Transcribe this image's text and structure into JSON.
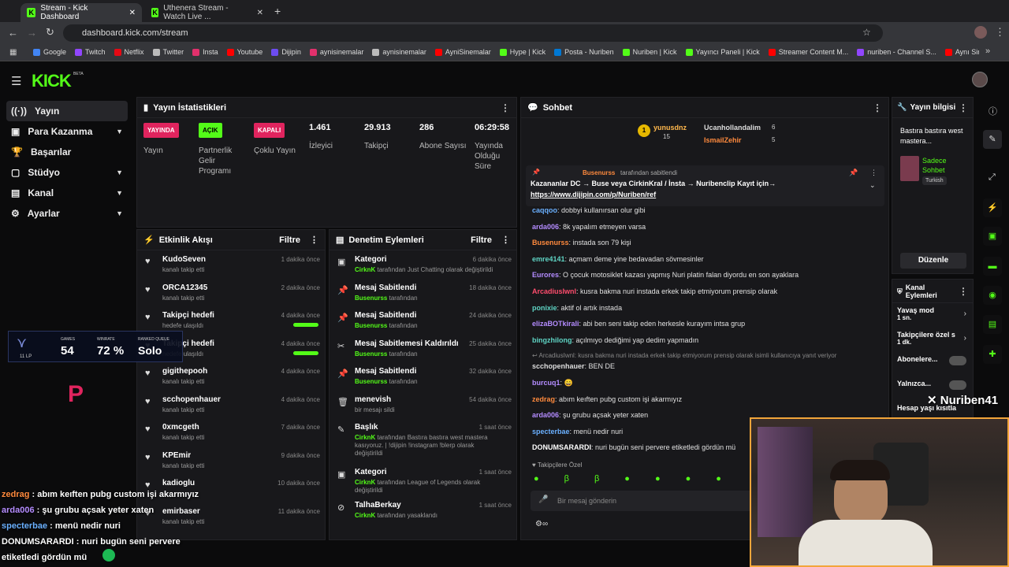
{
  "browser": {
    "tabs": [
      {
        "label": "Stream - Kick Dashboard"
      },
      {
        "label": "Uthenera Stream - Watch Live ..."
      }
    ],
    "url": "dashboard.kick.com/stream",
    "bookmarks": [
      {
        "label": "Google",
        "color": "#4285f4"
      },
      {
        "label": "Twitch",
        "color": "#9146ff"
      },
      {
        "label": "Netflix",
        "color": "#e50914"
      },
      {
        "label": "Twitter",
        "color": "#bbbbbb"
      },
      {
        "label": "Insta",
        "color": "#e1306c"
      },
      {
        "label": "Youtube",
        "color": "#ff0000"
      },
      {
        "label": "Dijipin",
        "color": "#6c4cf0"
      },
      {
        "label": "aynisinemalar",
        "color": "#e1306c"
      },
      {
        "label": "aynisinemalar",
        "color": "#bbbbbb"
      },
      {
        "label": "AyniSinemalar",
        "color": "#ff0000"
      },
      {
        "label": "Hype | Kick",
        "color": "#53fc18"
      },
      {
        "label": "Posta - Nuriben",
        "color": "#0078d4"
      },
      {
        "label": "Nuriben | Kick",
        "color": "#53fc18"
      },
      {
        "label": "Yayıncı Paneli | Kick",
        "color": "#53fc18"
      },
      {
        "label": "Streamer Content M...",
        "color": "#ff0000"
      },
      {
        "label": "nuriben - Channel S...",
        "color": "#9146ff"
      },
      {
        "label": "Aynı Sinemalar - Ça...",
        "color": "#ff0000"
      }
    ]
  },
  "brand": {
    "logo": "KICK",
    "beta": "BETA"
  },
  "sidebar": {
    "items": [
      {
        "label": "Yayın",
        "icon": "broadcast-icon"
      },
      {
        "label": "Para Kazanma",
        "icon": "money-icon"
      },
      {
        "label": "Başarılar",
        "icon": "trophy-icon"
      },
      {
        "label": "Stüdyo",
        "icon": "studio-icon"
      },
      {
        "label": "Kanal",
        "icon": "channel-icon"
      },
      {
        "label": "Ayarlar",
        "icon": "gear-icon"
      }
    ]
  },
  "stats": {
    "title": "Yayın İstatistikleri",
    "cols": [
      {
        "badge": "YAYINDA",
        "badge_color": "#e0245e",
        "label": "Yayın"
      },
      {
        "badge": "AÇIK",
        "badge_color": "#53fc18",
        "label": "Partnerlik Gelir Programı"
      },
      {
        "badge": "KAPALI",
        "badge_color": "#e0245e",
        "label": "Çoklu Yayın"
      },
      {
        "value": "1.461",
        "label": "İzleyici"
      },
      {
        "value": "29.913",
        "label": "Takipçi"
      },
      {
        "value": "286",
        "label": "Abone Sayısı"
      },
      {
        "value": "06:29:58",
        "label": "Yayında Olduğu Süre"
      }
    ]
  },
  "events": {
    "title": "Etkinlik Akışı",
    "filter": "Filtre",
    "items": [
      {
        "name": "KudoSeven",
        "sub": "kanalı takip etti",
        "time": "1 dakika önce"
      },
      {
        "name": "ORCA12345",
        "sub": "kanalı takip etti",
        "time": "2 dakika önce"
      },
      {
        "name": "Takipçi hedefi",
        "sub": "hedefe ulaşıldı",
        "time": "4 dakika önce"
      },
      {
        "name": "Takipçi hedefi",
        "sub": "hedefe ulaşıldı",
        "time": "4 dakika önce"
      },
      {
        "name": "gigithepooh",
        "sub": "kanalı takip etti",
        "time": "4 dakika önce"
      },
      {
        "name": "scchopenhauer",
        "sub": "kanalı takip etti",
        "time": "4 dakika önce"
      },
      {
        "name": "0xmcgeth",
        "sub": "kanalı takip etti",
        "time": "7 dakika önce"
      },
      {
        "name": "KPEmir",
        "sub": "kanalı takip etti",
        "time": "9 dakika önce"
      },
      {
        "name": "kadioglu",
        "sub": "",
        "time": "10 dakika önce"
      },
      {
        "name": "emirbaser",
        "sub": "kanalı takip etti",
        "time": "11 dakika önce"
      }
    ]
  },
  "mod": {
    "title": "Denetim Eylemleri",
    "filter": "Filtre",
    "items": [
      {
        "name": "Kategori",
        "user": "CirknK",
        "sub": "tarafından Just Chatting olarak değiştirildi",
        "time": "6 dakika önce"
      },
      {
        "name": "Mesaj Sabitlendi",
        "user": "Busenurss",
        "sub": "tarafından",
        "time": "18 dakika önce"
      },
      {
        "name": "Mesaj Sabitlendi",
        "user": "Busenurss",
        "sub": "tarafından",
        "time": "24 dakika önce"
      },
      {
        "name": "Mesaj Sabitlemesi Kaldırıldı",
        "user": "Busenurss",
        "sub": "tarafından",
        "time": "25 dakika önce"
      },
      {
        "name": "Mesaj Sabitlendi",
        "user": "Busenurss",
        "sub": "tarafından",
        "time": "32 dakika önce"
      },
      {
        "name": "menevish",
        "user": "",
        "sub": "bir mesajı sildi",
        "time": "54 dakika önce"
      },
      {
        "name": "Başlık",
        "user": "CirknK",
        "sub": "tarafından Bastıra bastıra west mastera kasıyoruz. | !dijipin !instagram !blerp olarak değiştirildi",
        "time": "1 saat önce"
      },
      {
        "name": "Kategori",
        "user": "CirknK",
        "sub": "tarafından League of Legends olarak değiştirildi",
        "time": "1 saat önce"
      },
      {
        "name": "TalhaBerkay",
        "user": "CirknK",
        "sub": "tarafından yasaklandı",
        "time": "1 saat önce"
      }
    ]
  },
  "chat": {
    "title": "Sohbet",
    "top": [
      {
        "name": "yunusdnz",
        "count": "15"
      },
      {
        "name": "Ucanhollandalim",
        "count": "6"
      },
      {
        "name": "IsmailZehir",
        "count": "5"
      }
    ],
    "pinned": {
      "by": "Busenurss",
      "suffix": "tarafından sabitlendi",
      "text": "Kazananlar DC → Buse veya CirkinKral / İnsta → Nuribenclip Kayıt için→",
      "link": "https://www.dijipin.com/p/Nuriben/ref"
    },
    "messages": [
      {
        "user": "caqqoo",
        "color": "#6ab0ff",
        "text": "dobbyi kullanırsan olur gibi"
      },
      {
        "user": "arda006",
        "color": "#b48cff",
        "text": "8k yapalım etmeyen varsa"
      },
      {
        "user": "Busenurss",
        "color": "#ff8a3d",
        "text": "instada son 79 kişi"
      },
      {
        "user": "emre4141",
        "color": "#5fd4c4",
        "text": "açmam deme yine bedavadan sövmesinler"
      },
      {
        "user": "Eurores",
        "color": "#b48cff",
        "text": "O çocuk motosiklet kazası yapmış Nuri platin falan diyordu en son ayaklara"
      },
      {
        "user": "ArcadiusIwnl",
        "color": "#ff4d6d",
        "text": "kusra bakma nuri instada erkek takip etmiyorum prensip olarak"
      },
      {
        "user": "ponixie",
        "color": "#5fd4c4",
        "text": "aktif ol artık instada"
      },
      {
        "user": "elizaBOTkirali",
        "color": "#b48cff",
        "text": "abi ben seni takip eden herkesle kurayım intsa grup"
      },
      {
        "user": "bingzhilong",
        "color": "#5fd4c4",
        "text": "açılmıyo dediğimi yap dedim yapmadın"
      },
      {
        "user": "scchopenhauer",
        "color": "#dddddd",
        "text": "BEN DE",
        "reply": "ArcadiusIwnl: kusra bakma nuri instada erkek takip etmiyorum prensip olarak isimli kullanıcıya yanıt veriyor"
      },
      {
        "user": "burcuq1",
        "color": "#b48cff",
        "text": "😄"
      },
      {
        "user": "zedrag",
        "color": "#ff8a3d",
        "text": "abım keıften pubg custom işi akarmıyız"
      },
      {
        "user": "arda006",
        "color": "#b48cff",
        "text": "şu grubu açsak yeter xaten"
      },
      {
        "user": "specterbae",
        "color": "#6ab0ff",
        "text": "menü nedir nuri"
      },
      {
        "user": "DONUMSARARDI",
        "color": "#ffffff",
        "text": "nuri bugün seni pervere etiketledi gördün mü"
      }
    ],
    "followers_only": "Takipçilere Özel",
    "placeholder": "Bir mesaj gönderin"
  },
  "info": {
    "title": "Yayın bilgisi",
    "stream_title": "Bastıra bastıra west mastera...",
    "category": "Sadece Sohbet",
    "language": "Turkish",
    "edit": "Düzenle"
  },
  "channel": {
    "title": "Kanal Eylemleri",
    "items": [
      {
        "label": "Yavaş mod",
        "sub": "1 sn."
      },
      {
        "label": "Takipçilere özel s",
        "sub": "1 dk."
      },
      {
        "label": "Abonelere...",
        "sub": ""
      },
      {
        "label": "Yalnızca...",
        "sub": ""
      },
      {
        "label": "Hesap yaşı kısıtla",
        "sub": ""
      }
    ]
  },
  "overlay": {
    "rank": {
      "games_label": "GAMES",
      "games": "54",
      "winrate_label": "WINRATE",
      "winrate": "72 %",
      "queue_label": "RANKED QUEUE",
      "queue": "Solo",
      "lp": "11 LP"
    },
    "chat": [
      {
        "user": "zedrag",
        "text": "abım keıften pubg custom işi akarmıyız"
      },
      {
        "user": "arda006",
        "text": "şu grubu açsak yeter xaten"
      },
      {
        "user": "specterbae",
        "text": "menü nedir nuri"
      },
      {
        "user": "DONUMSARARDI",
        "text": "nuri bugün seni pervere"
      },
      {
        "user": "",
        "text": "etiketledi gördün mü"
      }
    ],
    "handle": "Nuriben41"
  }
}
